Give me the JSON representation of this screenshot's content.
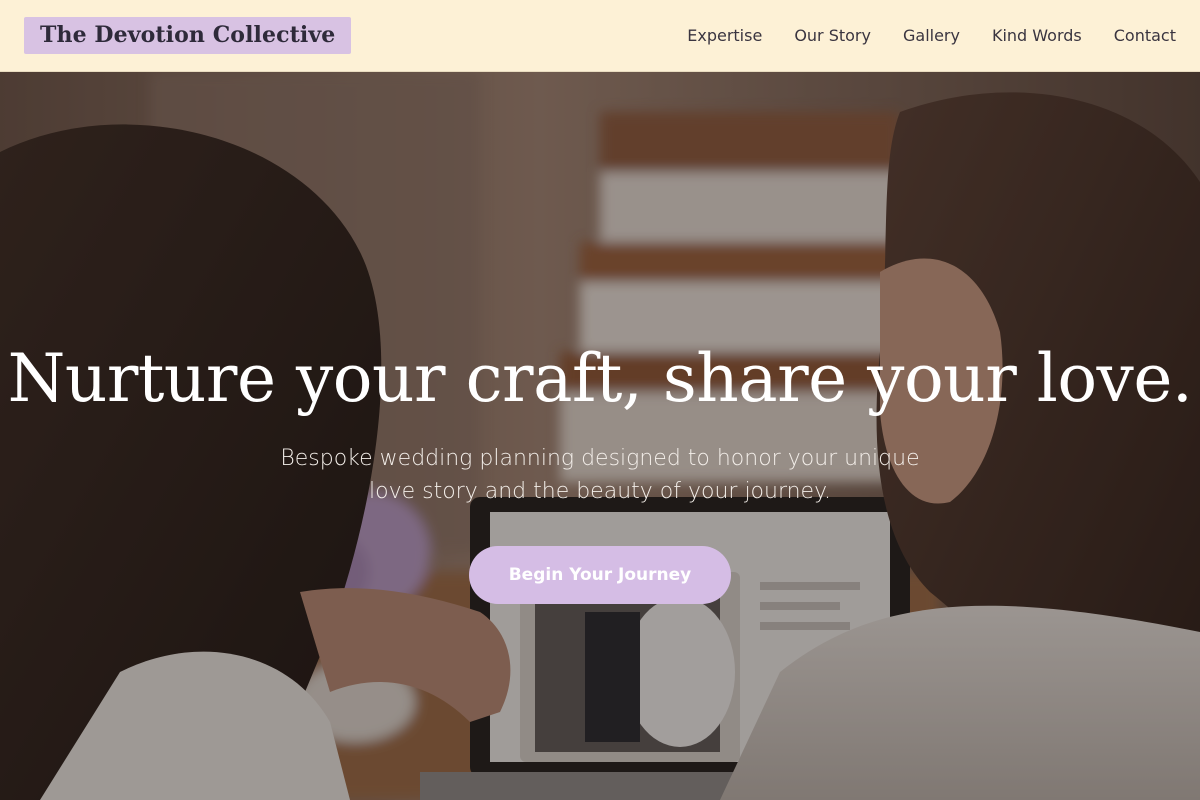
{
  "header": {
    "logo_text": "The Devotion Collective",
    "nav": [
      {
        "label": "Expertise"
      },
      {
        "label": "Our Story"
      },
      {
        "label": "Gallery"
      },
      {
        "label": "Kind Words"
      },
      {
        "label": "Contact"
      }
    ]
  },
  "hero": {
    "title": "Nurture your craft, share your love.",
    "subtitle": "Bespoke wedding planning designed to honor your unique love story and the beauty of your journey.",
    "cta_label": "Begin Your Journey",
    "background_image": "photo-two-women-at-laptop"
  },
  "colors": {
    "header_bg": "#fdf1d6",
    "logo_bg": "#d8c2e3",
    "cta_bg": "#d5bde5",
    "text_dark": "#3a3540"
  }
}
